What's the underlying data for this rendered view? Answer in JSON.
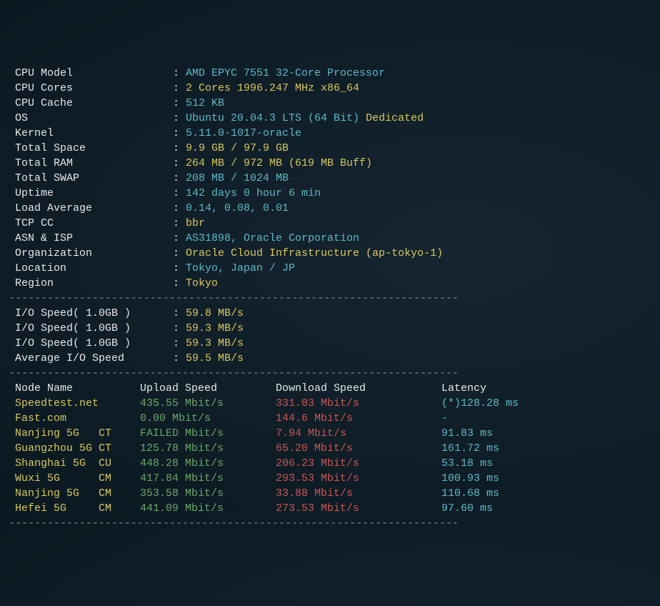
{
  "system": [
    {
      "label": "CPU Model",
      "value": "AMD EPYC 7551 32-Core Processor",
      "valueClass": "cyan"
    },
    {
      "label": "CPU Cores",
      "value": "2 Cores 1996.247 MHz x86_64",
      "valueClass": "yellow"
    },
    {
      "label": "CPU Cache",
      "value": "512 KB",
      "valueClass": "cyan"
    },
    {
      "label": "OS",
      "value": "Ubuntu 20.04.3 LTS (64 Bit)",
      "valueClass": "cyan",
      "extra": "Dedicated",
      "extraClass": "yellow"
    },
    {
      "label": "Kernel",
      "value": "5.11.0-1017-oracle",
      "valueClass": "cyan"
    },
    {
      "label": "Total Space",
      "value": "9.9 GB / 97.9 GB",
      "valueClass": "yellow"
    },
    {
      "label": "Total RAM",
      "value": "264 MB / 972 MB (619 MB Buff)",
      "valueClass": "yellow"
    },
    {
      "label": "Total SWAP",
      "value": "208 MB / 1024 MB",
      "valueClass": "cyan"
    },
    {
      "label": "Uptime",
      "value": "142 days 0 hour 6 min",
      "valueClass": "cyan"
    },
    {
      "label": "Load Average",
      "value": "0.14, 0.08, 0.01",
      "valueClass": "cyan"
    },
    {
      "label": "TCP CC",
      "value": "bbr",
      "valueClass": "yellow"
    },
    {
      "label": "ASN & ISP",
      "value": "AS31898, Oracle Corporation",
      "valueClass": "cyan"
    },
    {
      "label": "Organization",
      "value": "Oracle Cloud Infrastructure (ap-tokyo-1)",
      "valueClass": "yellow"
    },
    {
      "label": "Location",
      "value": "Tokyo, Japan / JP",
      "valueClass": "cyan"
    },
    {
      "label": "Region",
      "value": "Tokyo",
      "valueClass": "yellow"
    }
  ],
  "io": [
    {
      "label": "I/O Speed( 1.0GB )",
      "value": "59.8 MB/s"
    },
    {
      "label": "I/O Speed( 1.0GB )",
      "value": "59.3 MB/s"
    },
    {
      "label": "I/O Speed( 1.0GB )",
      "value": "59.3 MB/s"
    },
    {
      "label": "Average I/O Speed",
      "value": "59.5 MB/s"
    }
  ],
  "netheader": {
    "node": "Node Name",
    "upload": "Upload Speed",
    "download": "Download Speed",
    "latency": "Latency"
  },
  "net": [
    {
      "node": "Speedtest.net",
      "upload": "435.55 Mbit/s",
      "download": "331.03 Mbit/s",
      "latency": "(*)128.28 ms"
    },
    {
      "node": "Fast.com",
      "upload": "0.00 Mbit/s",
      "download": "144.6 Mbit/s",
      "latency": "-"
    },
    {
      "node": "Nanjing 5G   CT",
      "upload": "FAILED Mbit/s",
      "download": "7.94 Mbit/s",
      "latency": "91.83 ms"
    },
    {
      "node": "Guangzhou 5G CT",
      "upload": "125.78 Mbit/s",
      "download": "65.20 Mbit/s",
      "latency": "161.72 ms"
    },
    {
      "node": "Shanghai 5G  CU",
      "upload": "448.28 Mbit/s",
      "download": "206.23 Mbit/s",
      "latency": "53.18 ms"
    },
    {
      "node": "Wuxi 5G      CM",
      "upload": "417.84 Mbit/s",
      "download": "293.53 Mbit/s",
      "latency": "100.93 ms"
    },
    {
      "node": "Nanjing 5G   CM",
      "upload": "353.58 Mbit/s",
      "download": "33.88 Mbit/s",
      "latency": "110.68 ms"
    },
    {
      "node": "Hefei 5G     CM",
      "upload": "441.09 Mbit/s",
      "download": "273.53 Mbit/s",
      "latency": "97.60 ms"
    }
  ],
  "divider": "----------------------------------------------------------------------"
}
